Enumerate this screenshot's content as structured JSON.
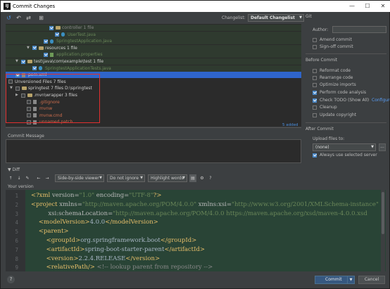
{
  "window": {
    "title": "Commit Changes",
    "logo_text": "IJ",
    "minimize": "—",
    "maximize": "☐",
    "close": "✕"
  },
  "toolbar": {
    "changelist_label": "Changelist:",
    "changelist_value": "Default Changelist",
    "icons": [
      "refresh-icon",
      "rollback-icon",
      "diff-icon",
      "group-by-icon"
    ]
  },
  "tree": {
    "rows": [
      {
        "indent": 62,
        "arrow": "",
        "checked": true,
        "icon": "folder",
        "text": "controller 1 file",
        "cls": "t-gray"
      },
      {
        "indent": 70,
        "arrow": "",
        "checked": true,
        "icon": "java",
        "text": "UserTest.java",
        "cls": "t-green"
      },
      {
        "indent": 54,
        "arrow": "",
        "checked": true,
        "icon": "java",
        "text": "SpringtestApplication.java",
        "cls": "t-green"
      },
      {
        "indent": 38,
        "arrow": "▼",
        "checked": true,
        "icon": "folder",
        "text": "resources 1 file",
        "cls": "t-white"
      },
      {
        "indent": 54,
        "arrow": "",
        "checked": true,
        "icon": "prop",
        "text": "application.properties",
        "cls": "t-green"
      },
      {
        "indent": 22,
        "arrow": "▼",
        "checked": true,
        "icon": "folder",
        "text": "test\\java\\com\\example\\test 1 file",
        "cls": "t-white"
      },
      {
        "indent": 38,
        "arrow": "",
        "checked": true,
        "icon": "java",
        "text": "SpringtestApplicationTests.java",
        "cls": "t-green"
      },
      {
        "indent": 14,
        "arrow": "",
        "checked": true,
        "icon": "gray",
        "text": "pom.xml",
        "cls": "t-white",
        "sel": true
      },
      {
        "indent": 4,
        "arrow": "▼",
        "checked": false,
        "icon": "",
        "text": "Unversioned Files 7 files",
        "cls": "t-white"
      },
      {
        "indent": 14,
        "arrow": "▼",
        "checked": false,
        "icon": "folder",
        "text": "springtest 7 files  D:\\springtest",
        "cls": "t-white"
      },
      {
        "indent": 22,
        "arrow": "▶",
        "checked": false,
        "icon": "folder",
        "text": ".mvn\\wrapper 3 files",
        "cls": "t-white"
      },
      {
        "indent": 30,
        "arrow": "",
        "checked": false,
        "icon": "gray",
        "text": ".gitignore",
        "cls": "t-red"
      },
      {
        "indent": 30,
        "arrow": "",
        "checked": false,
        "icon": "gray",
        "text": "mvnw",
        "cls": "t-red"
      },
      {
        "indent": 30,
        "arrow": "",
        "checked": false,
        "icon": "gray",
        "text": "mvnw.cmd",
        "cls": "t-red"
      },
      {
        "indent": 30,
        "arrow": "",
        "checked": false,
        "icon": "gray",
        "text": "unnamed.patch",
        "cls": "t-red"
      }
    ],
    "added_text": "5 added"
  },
  "commit_message": {
    "label": "Commit Message"
  },
  "git": {
    "title": "Git",
    "author_label": "Author:",
    "amend_commit": "Amend commit",
    "sign_off_commit": "Sign-off commit",
    "before_commit_title": "Before Commit",
    "reformat_code": "Reformat code",
    "rearrange_code": "Rearrange code",
    "optimize_imports": "Optimize imports",
    "perform_code_analysis": "Perform code analysis",
    "check_todo": "Check TODO (Show All)",
    "configure_link": "Configure",
    "cleanup": "Cleanup",
    "update_copyright": "Update copyright",
    "after_commit_title": "After Commit",
    "upload_files_label": "Upload files to:",
    "upload_target": "(none)",
    "always_use_server": "Always use selected server",
    "dots": "..."
  },
  "diff": {
    "label": "Diff",
    "viewer": "Side-by-side viewer",
    "ignore": "Do not ignore",
    "highlight": "Highlight words",
    "help": "?",
    "your_version": "Your version",
    "lines": [
      {
        "n": "1",
        "html": "<span class='k'>&lt;?xml </span><span class='a'>version=</span><span class='s'>\"1.0\"</span><span class='a'> encoding=</span><span class='s'>\"UTF-8\"</span><span class='k'>?&gt;</span>"
      },
      {
        "n": "2",
        "html": "<span class='k'>&lt;project </span><span class='a'>xmlns=</span><span class='s'>\"http://maven.apache.org/POM/4.0.0\"</span><span class='a'> xmlns:xsi=</span><span class='s'>\"http://www.w3.org/2001/XMLSchema-instance\"</span>"
      },
      {
        "n": "3",
        "html": "         <span class='a'>xsi:schemaLocation=</span><span class='s'>\"http://maven.apache.org/POM/4.0.0 https://maven.apache.org/xsd/maven-4.0.0.xsd</span>"
      },
      {
        "n": "4",
        "html": "    <span class='k'>&lt;modelVersion&gt;</span>4.0.0<span class='k'>&lt;/modelVersion&gt;</span>"
      },
      {
        "n": "5",
        "html": "    <span class='k'>&lt;parent&gt;</span>"
      },
      {
        "n": "6",
        "html": "        <span class='k'>&lt;groupId&gt;</span>org.springframework.boot<span class='k'>&lt;/groupId&gt;</span>"
      },
      {
        "n": "7",
        "html": "        <span class='k'>&lt;artifactId&gt;</span>spring-boot-starter-parent<span class='k'>&lt;/artifactId&gt;</span>"
      },
      {
        "n": "8",
        "html": "        <span class='k'>&lt;version&gt;</span>2.2.4.RELEASE<span class='k'>&lt;/version&gt;</span>"
      },
      {
        "n": "9",
        "html": "        <span class='k'>&lt;relativePath</span><span class='k'>/&gt;</span> <span class='t-gray'>&lt;!-- lookup parent from repository --&gt;</span>"
      }
    ]
  },
  "footer": {
    "commit": "Commit",
    "cancel": "Cancel",
    "help": "?"
  }
}
